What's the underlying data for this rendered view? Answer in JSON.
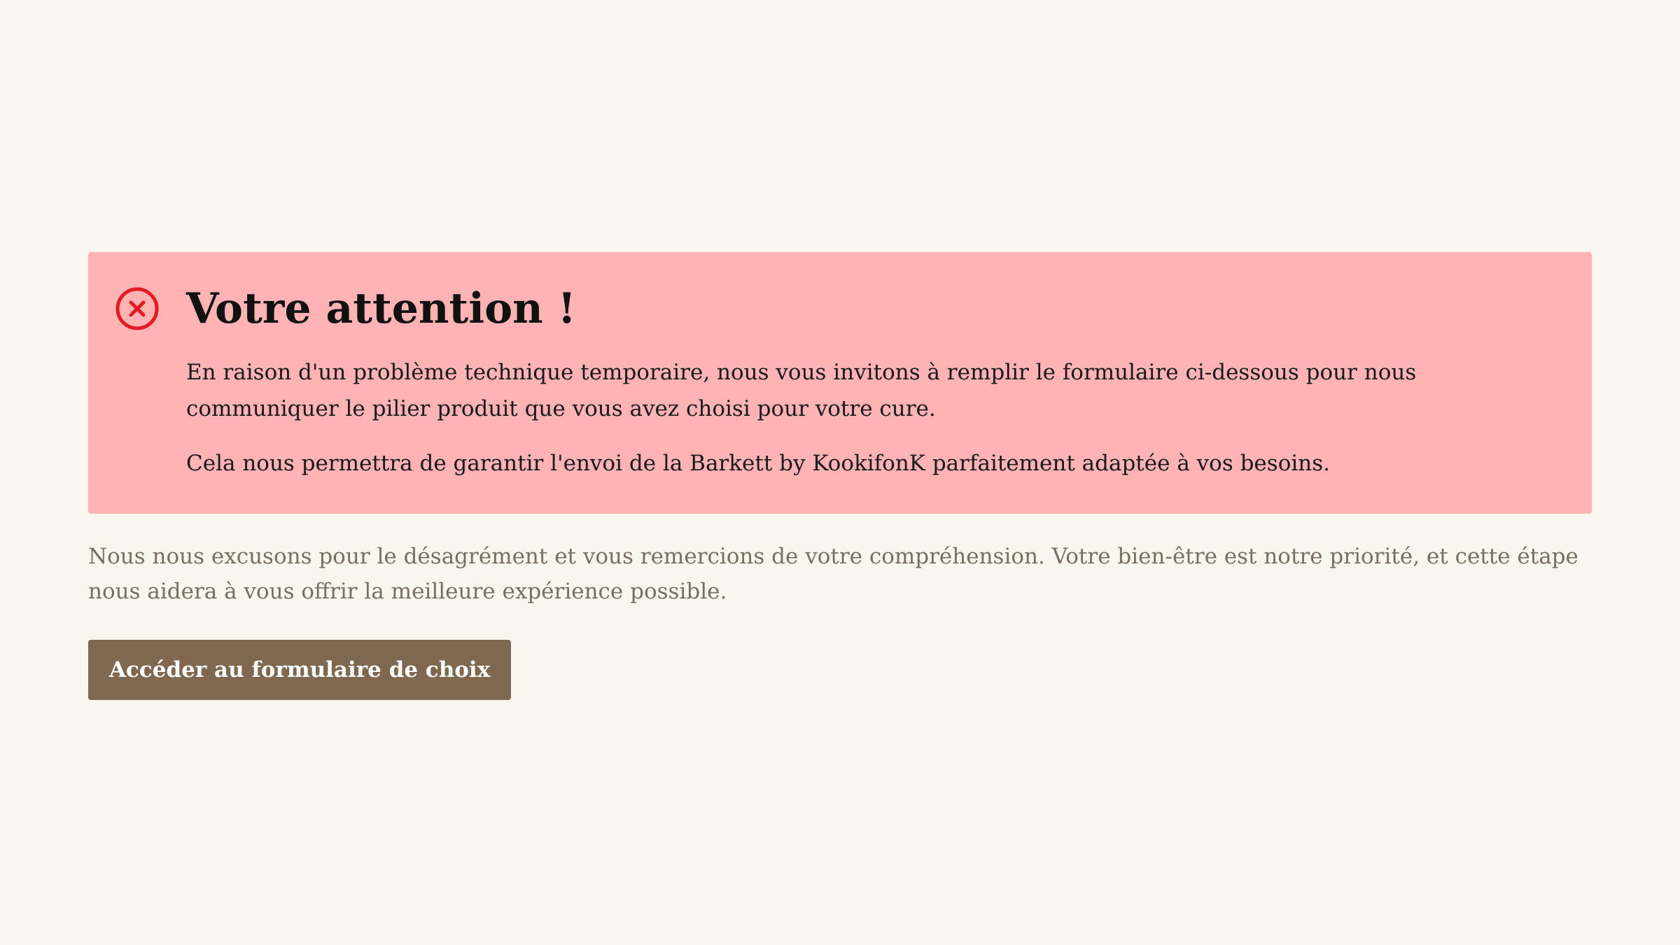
{
  "alert": {
    "icon": "error-circle-x-icon",
    "color": "#e41b23",
    "background": "#ffb3b5",
    "title": "Votre attention !",
    "paragraphs": [
      "En raison d'un problème technique temporaire, nous vous invitons à remplir le formulaire ci-dessous pour nous communiquer le pilier produit que vous avez choisi pour votre cure.",
      "Cela nous permettra de garantir l'envoi de la Barkett by KookifonK parfaitement adaptée à vos besoins."
    ]
  },
  "note": "Nous nous excusons pour le désagrément et vous remercions de votre compréhension. Votre bien-être est notre priorité, et cette étape nous aidera à vous offrir la meilleure expérience possible.",
  "cta": {
    "label": "Accéder au formulaire de choix",
    "color": "#806850"
  },
  "page_background": "#f9f6ef"
}
